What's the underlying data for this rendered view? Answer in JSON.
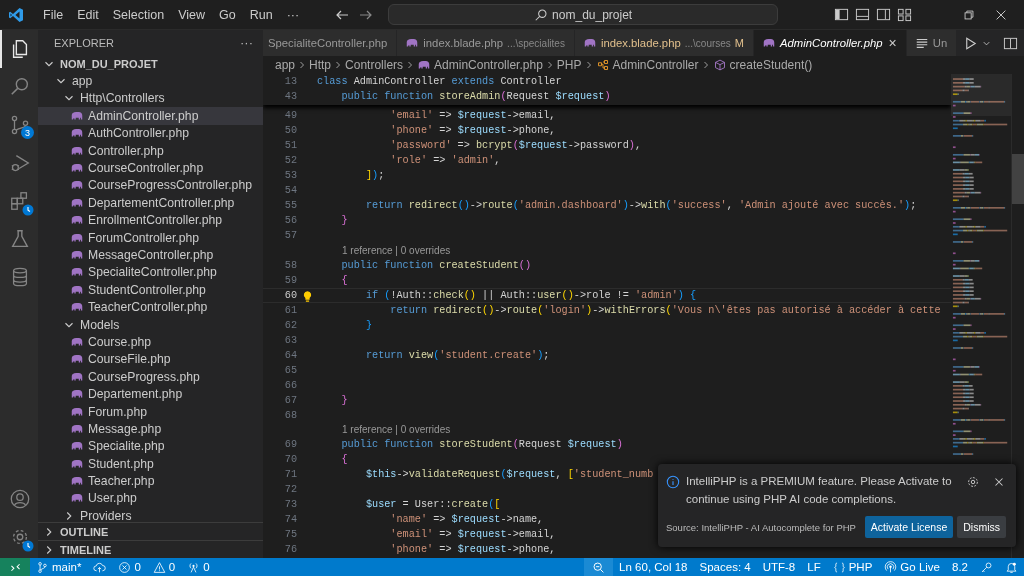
{
  "menu": [
    "File",
    "Edit",
    "Selection",
    "View",
    "Go",
    "Run",
    "···"
  ],
  "command_center": {
    "text": "nom_du_projet"
  },
  "activity_bar": {
    "items": [
      {
        "kind": "explorer",
        "selected": true,
        "clock_badge": false
      },
      {
        "kind": "search",
        "selected": false,
        "clock_badge": false
      },
      {
        "kind": "source-control",
        "selected": false,
        "clock_badge": false,
        "badge": "3"
      },
      {
        "kind": "debug",
        "selected": false,
        "clock_badge": false
      },
      {
        "kind": "extensions",
        "selected": false,
        "clock_badge": true
      },
      {
        "kind": "testing",
        "selected": false,
        "clock_badge": false
      },
      {
        "kind": "database",
        "selected": false,
        "clock_badge": false
      }
    ],
    "bottom": [
      {
        "kind": "account",
        "clock_badge": false
      },
      {
        "kind": "settings",
        "clock_badge": true
      }
    ]
  },
  "explorer": {
    "title": "EXPLORER",
    "more": "···",
    "root": {
      "label": "NOM_DU_PROJET",
      "expanded": true
    },
    "tree": [
      {
        "kind": "folder",
        "label": "app",
        "expanded": true,
        "selected": false,
        "children": [
          {
            "kind": "folder",
            "label": "Http\\Controllers",
            "expanded": true,
            "selected": false,
            "children": [
              {
                "kind": "file",
                "label": "AdminController.php",
                "selected": true
              },
              {
                "kind": "file",
                "label": "AuthController.php",
                "selected": false
              },
              {
                "kind": "file",
                "label": "Controller.php",
                "selected": false
              },
              {
                "kind": "file",
                "label": "CourseController.php",
                "selected": false
              },
              {
                "kind": "file",
                "label": "CourseProgressController.php",
                "selected": false
              },
              {
                "kind": "file",
                "label": "DepartementController.php",
                "selected": false
              },
              {
                "kind": "file",
                "label": "EnrollmentController.php",
                "selected": false
              },
              {
                "kind": "file",
                "label": "ForumController.php",
                "selected": false
              },
              {
                "kind": "file",
                "label": "MessageController.php",
                "selected": false
              },
              {
                "kind": "file",
                "label": "SpecialiteController.php",
                "selected": false
              },
              {
                "kind": "file",
                "label": "StudentController.php",
                "selected": false
              },
              {
                "kind": "file",
                "label": "TeacherController.php",
                "selected": false
              }
            ]
          },
          {
            "kind": "folder",
            "label": "Models",
            "expanded": true,
            "selected": false,
            "children": [
              {
                "kind": "file",
                "label": "Course.php",
                "selected": false
              },
              {
                "kind": "file",
                "label": "CourseFile.php",
                "selected": false
              },
              {
                "kind": "file",
                "label": "CourseProgress.php",
                "selected": false
              },
              {
                "kind": "file",
                "label": "Departement.php",
                "selected": false
              },
              {
                "kind": "file",
                "label": "Forum.php",
                "selected": false
              },
              {
                "kind": "file",
                "label": "Message.php",
                "selected": false
              },
              {
                "kind": "file",
                "label": "Specialite.php",
                "selected": false
              },
              {
                "kind": "file",
                "label": "Student.php",
                "selected": false
              },
              {
                "kind": "file",
                "label": "Teacher.php",
                "selected": false
              },
              {
                "kind": "file",
                "label": "User.php",
                "selected": false
              }
            ]
          },
          {
            "kind": "folder",
            "label": "Providers",
            "expanded": false,
            "selected": false
          }
        ]
      }
    ],
    "sections": [
      {
        "label": "OUTLINE",
        "expanded": false
      },
      {
        "label": "TIMELINE",
        "expanded": false
      }
    ]
  },
  "tabs": [
    {
      "kind": "php",
      "label": "SpecialiteController.php",
      "selected": false,
      "preview": false,
      "modified": false
    },
    {
      "kind": "php",
      "label": "index.blade.php",
      "description": "...\\specialites",
      "selected": false,
      "preview": false,
      "modified": false
    },
    {
      "kind": "php",
      "label": "index.blade.php",
      "description": "...\\courses",
      "selected": false,
      "preview": false,
      "modified": true,
      "modified_mark": "M"
    },
    {
      "kind": "php",
      "label": "AdminController.php",
      "selected": true,
      "preview": true,
      "modified": false,
      "close": "×"
    },
    {
      "kind": "text",
      "label": "Un",
      "selected": false,
      "preview": false,
      "modified": false
    }
  ],
  "breadcrumb": [
    {
      "kind": "folder",
      "text": "app"
    },
    {
      "kind": "folder",
      "text": "Http"
    },
    {
      "kind": "folder",
      "text": "Controllers"
    },
    {
      "kind": "file",
      "text": "AdminController.php"
    },
    {
      "kind": "folder",
      "text": "PHP"
    },
    {
      "kind": "class",
      "text": "AdminController"
    },
    {
      "kind": "method",
      "text": "createStudent()"
    }
  ],
  "code": {
    "sticky": [
      {
        "n": "13",
        "tokens": [
          {
            "kind": "kw",
            "text": "class "
          },
          {
            "kind": "op",
            "text": "AdminController "
          },
          {
            "kind": "kw",
            "text": "extends "
          },
          {
            "kind": "op",
            "text": "Controller"
          }
        ]
      },
      {
        "n": "43",
        "tokens": [
          {
            "kind": "kw",
            "text": "    public function "
          },
          {
            "kind": "fn",
            "text": "storeAdmin"
          },
          {
            "kind": "b2",
            "text": "("
          },
          {
            "kind": "op",
            "text": "Request "
          },
          {
            "kind": "var",
            "text": "$request"
          },
          {
            "kind": "b2",
            "text": ")"
          }
        ]
      }
    ],
    "lines": [
      {
        "kind": "code",
        "n": "49",
        "current": false,
        "lightbulb": false,
        "tokens": [
          {
            "kind": "str",
            "text": "            'email'"
          },
          {
            "kind": "op",
            "text": " => "
          },
          {
            "kind": "var",
            "text": "$request"
          },
          {
            "kind": "op",
            "text": "->email,"
          }
        ]
      },
      {
        "kind": "code",
        "n": "50",
        "current": false,
        "lightbulb": false,
        "tokens": [
          {
            "kind": "str",
            "text": "            'phone'"
          },
          {
            "kind": "op",
            "text": " => "
          },
          {
            "kind": "var",
            "text": "$request"
          },
          {
            "kind": "op",
            "text": "->phone,"
          }
        ]
      },
      {
        "kind": "code",
        "n": "51",
        "current": false,
        "lightbulb": false,
        "tokens": [
          {
            "kind": "str",
            "text": "            'password'"
          },
          {
            "kind": "op",
            "text": " => "
          },
          {
            "kind": "fn",
            "text": "bcrypt"
          },
          {
            "kind": "b2",
            "text": "("
          },
          {
            "kind": "var",
            "text": "$request"
          },
          {
            "kind": "op",
            "text": "->password"
          },
          {
            "kind": "b2",
            "text": ")"
          },
          {
            "kind": "op",
            "text": ","
          }
        ]
      },
      {
        "kind": "code",
        "n": "52",
        "current": false,
        "lightbulb": false,
        "tokens": [
          {
            "kind": "str",
            "text": "            'role'"
          },
          {
            "kind": "op",
            "text": " => "
          },
          {
            "kind": "str",
            "text": "'admin'"
          },
          {
            "kind": "op",
            "text": ","
          }
        ]
      },
      {
        "kind": "code",
        "n": "53",
        "current": false,
        "lightbulb": false,
        "tokens": [
          {
            "kind": "b1",
            "text": "        ]"
          },
          {
            "kind": "b3",
            "text": ")"
          },
          {
            "kind": "op",
            "text": ";"
          }
        ]
      },
      {
        "kind": "code",
        "n": "54",
        "current": false,
        "lightbulb": false
      },
      {
        "kind": "code",
        "n": "55",
        "current": false,
        "lightbulb": false,
        "tokens": [
          {
            "kind": "kw",
            "text": "        return "
          },
          {
            "kind": "fn",
            "text": "redirect"
          },
          {
            "kind": "b3",
            "text": "()"
          },
          {
            "kind": "op",
            "text": "->"
          },
          {
            "kind": "fn",
            "text": "route"
          },
          {
            "kind": "b3",
            "text": "("
          },
          {
            "kind": "str",
            "text": "'admin.dashboard'"
          },
          {
            "kind": "b3",
            "text": ")"
          },
          {
            "kind": "op",
            "text": "->"
          },
          {
            "kind": "fn",
            "text": "with"
          },
          {
            "kind": "b3",
            "text": "("
          },
          {
            "kind": "str",
            "text": "'success'"
          },
          {
            "kind": "op",
            "text": ", "
          },
          {
            "kind": "str",
            "text": "'Admin ajouté avec succès.'"
          },
          {
            "kind": "b3",
            "text": ")"
          },
          {
            "kind": "op",
            "text": ";"
          }
        ]
      },
      {
        "kind": "code",
        "n": "56",
        "current": false,
        "lightbulb": false,
        "tokens": [
          {
            "kind": "b2",
            "text": "    }"
          }
        ]
      },
      {
        "kind": "code",
        "n": "57",
        "current": false,
        "lightbulb": false
      },
      {
        "kind": "codelens",
        "text": "1 reference | 0 overrides"
      },
      {
        "kind": "code",
        "n": "58",
        "current": false,
        "lightbulb": false,
        "tokens": [
          {
            "kind": "kw",
            "text": "    public function "
          },
          {
            "kind": "fn",
            "text": "createStudent"
          },
          {
            "kind": "b2",
            "text": "()"
          }
        ]
      },
      {
        "kind": "code",
        "n": "59",
        "current": false,
        "lightbulb": false,
        "tokens": [
          {
            "kind": "b2",
            "text": "    {"
          }
        ]
      },
      {
        "kind": "code",
        "n": "60",
        "current": true,
        "lightbulb": true,
        "tokens": [
          {
            "kind": "kw",
            "text": "        if "
          },
          {
            "kind": "b3",
            "text": "("
          },
          {
            "kind": "op",
            "text": "!Auth::"
          },
          {
            "kind": "fn",
            "text": "check"
          },
          {
            "kind": "b1",
            "text": "()"
          },
          {
            "kind": "op",
            "text": " || Auth::"
          },
          {
            "kind": "fn",
            "text": "user"
          },
          {
            "kind": "b1",
            "text": "()"
          },
          {
            "kind": "op",
            "text": "->role != "
          },
          {
            "kind": "str",
            "text": "'admin'"
          },
          {
            "kind": "b3",
            "text": ")"
          },
          {
            "kind": "b3",
            "text": " {"
          }
        ]
      },
      {
        "kind": "code",
        "n": "61",
        "current": false,
        "lightbulb": false,
        "tokens": [
          {
            "kind": "kw",
            "text": "            return "
          },
          {
            "kind": "fn",
            "text": "redirect"
          },
          {
            "kind": "b1",
            "text": "()"
          },
          {
            "kind": "op",
            "text": "->"
          },
          {
            "kind": "fn",
            "text": "route"
          },
          {
            "kind": "b1",
            "text": "("
          },
          {
            "kind": "str",
            "text": "'login'"
          },
          {
            "kind": "b1",
            "text": ")"
          },
          {
            "kind": "op",
            "text": "->"
          },
          {
            "kind": "fn",
            "text": "withErrors"
          },
          {
            "kind": "b1",
            "text": "("
          },
          {
            "kind": "str",
            "text": "'Vous n\\'êtes pas autorisé à accéder à cette"
          }
        ]
      },
      {
        "kind": "code",
        "n": "62",
        "current": false,
        "lightbulb": false,
        "tokens": [
          {
            "kind": "b3",
            "text": "        }"
          }
        ]
      },
      {
        "kind": "code",
        "n": "63",
        "current": false,
        "lightbulb": false
      },
      {
        "kind": "code",
        "n": "64",
        "current": false,
        "lightbulb": false,
        "tokens": [
          {
            "kind": "kw",
            "text": "        return "
          },
          {
            "kind": "fn",
            "text": "view"
          },
          {
            "kind": "b3",
            "text": "("
          },
          {
            "kind": "str",
            "text": "'student.create'"
          },
          {
            "kind": "b3",
            "text": ")"
          },
          {
            "kind": "op",
            "text": ";"
          }
        ]
      },
      {
        "kind": "code",
        "n": "65",
        "current": false,
        "lightbulb": false
      },
      {
        "kind": "code",
        "n": "66",
        "current": false,
        "lightbulb": false
      },
      {
        "kind": "code",
        "n": "67",
        "current": false,
        "lightbulb": false,
        "tokens": [
          {
            "kind": "b2",
            "text": "    }"
          }
        ]
      },
      {
        "kind": "code",
        "n": "68",
        "current": false,
        "lightbulb": false
      },
      {
        "kind": "codelens",
        "text": "1 reference | 0 overrides"
      },
      {
        "kind": "code",
        "n": "69",
        "current": false,
        "lightbulb": false,
        "tokens": [
          {
            "kind": "kw",
            "text": "    public function "
          },
          {
            "kind": "fn",
            "text": "storeStudent"
          },
          {
            "kind": "b2",
            "text": "("
          },
          {
            "kind": "op",
            "text": "Request "
          },
          {
            "kind": "var",
            "text": "$request"
          },
          {
            "kind": "b2",
            "text": ")"
          }
        ]
      },
      {
        "kind": "code",
        "n": "70",
        "current": false,
        "lightbulb": false,
        "tokens": [
          {
            "kind": "b2",
            "text": "    {"
          }
        ]
      },
      {
        "kind": "code",
        "n": "71",
        "current": false,
        "lightbulb": false,
        "tokens": [
          {
            "kind": "var",
            "text": "        $this"
          },
          {
            "kind": "op",
            "text": "->"
          },
          {
            "kind": "fn",
            "text": "validateRequest"
          },
          {
            "kind": "b3",
            "text": "("
          },
          {
            "kind": "var",
            "text": "$request"
          },
          {
            "kind": "op",
            "text": ", "
          },
          {
            "kind": "b1",
            "text": "["
          },
          {
            "kind": "str",
            "text": "'student_numb"
          }
        ]
      },
      {
        "kind": "code",
        "n": "72",
        "current": false,
        "lightbulb": false
      },
      {
        "kind": "code",
        "n": "73",
        "current": false,
        "lightbulb": false,
        "tokens": [
          {
            "kind": "var",
            "text": "        $user"
          },
          {
            "kind": "op",
            "text": " = User::"
          },
          {
            "kind": "fn",
            "text": "create"
          },
          {
            "kind": "b3",
            "text": "("
          },
          {
            "kind": "b1",
            "text": "["
          }
        ]
      },
      {
        "kind": "code",
        "n": "74",
        "current": false,
        "lightbulb": false,
        "tokens": [
          {
            "kind": "str",
            "text": "            'name'"
          },
          {
            "kind": "op",
            "text": " => "
          },
          {
            "kind": "var",
            "text": "$request"
          },
          {
            "kind": "op",
            "text": "->name,"
          }
        ]
      },
      {
        "kind": "code",
        "n": "75",
        "current": false,
        "lightbulb": false,
        "tokens": [
          {
            "kind": "str",
            "text": "            'email'"
          },
          {
            "kind": "op",
            "text": " => "
          },
          {
            "kind": "var",
            "text": "$request"
          },
          {
            "kind": "op",
            "text": "->email,"
          }
        ]
      },
      {
        "kind": "code",
        "n": "76",
        "current": false,
        "lightbulb": false,
        "tokens": [
          {
            "kind": "str",
            "text": "            'phone'"
          },
          {
            "kind": "op",
            "text": " => "
          },
          {
            "kind": "var",
            "text": "$request"
          },
          {
            "kind": "op",
            "text": "->phone,"
          }
        ]
      }
    ]
  },
  "notification": {
    "message": "IntelliPHP is a PREMIUM feature. Please Activate to continue using PHP AI code completions.",
    "source": "Source: IntelliPHP - AI Autocomplete for PHP",
    "actions": [
      {
        "label": "Activate License",
        "primary": true
      },
      {
        "label": "Dismiss",
        "primary": false
      }
    ]
  },
  "status_bar": {
    "left": [
      {
        "kind": "remote"
      },
      {
        "kind": "branch",
        "text": "main*"
      },
      {
        "kind": "sync"
      },
      {
        "kind": "errors",
        "text": "0"
      },
      {
        "kind": "warnings",
        "text": "0"
      },
      {
        "kind": "ports",
        "text": "0"
      }
    ],
    "right": [
      {
        "kind": "zoom"
      },
      {
        "kind": "text",
        "text": "Ln 60, Col 18"
      },
      {
        "kind": "text",
        "text": "Spaces: 4"
      },
      {
        "kind": "text",
        "text": "UTF-8"
      },
      {
        "kind": "text",
        "text": "LF"
      },
      {
        "kind": "language",
        "text": "PHP"
      },
      {
        "kind": "golive",
        "text": "Go Live"
      },
      {
        "kind": "text",
        "text": "8.2"
      },
      {
        "kind": "key"
      },
      {
        "kind": "bell"
      }
    ]
  }
}
